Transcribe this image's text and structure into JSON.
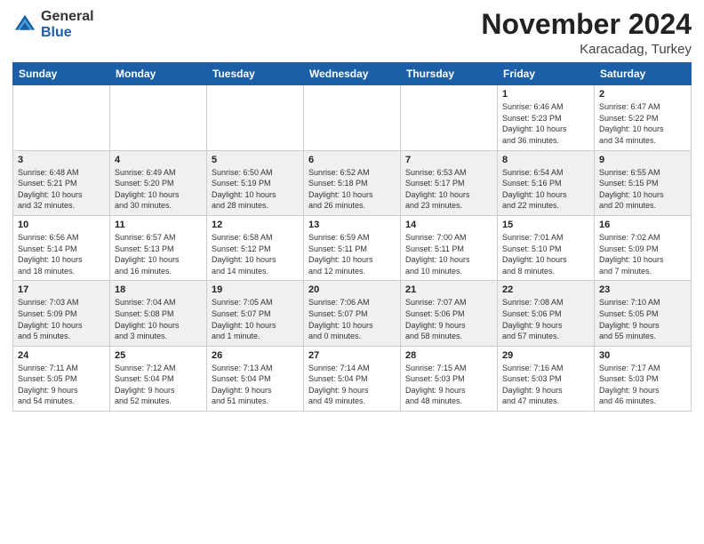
{
  "header": {
    "logo_line1": "General",
    "logo_line2": "Blue",
    "month": "November 2024",
    "location": "Karacadag, Turkey"
  },
  "columns": [
    "Sunday",
    "Monday",
    "Tuesday",
    "Wednesday",
    "Thursday",
    "Friday",
    "Saturday"
  ],
  "weeks": [
    [
      {
        "day": "",
        "info": ""
      },
      {
        "day": "",
        "info": ""
      },
      {
        "day": "",
        "info": ""
      },
      {
        "day": "",
        "info": ""
      },
      {
        "day": "",
        "info": ""
      },
      {
        "day": "1",
        "info": "Sunrise: 6:46 AM\nSunset: 5:23 PM\nDaylight: 10 hours\nand 36 minutes."
      },
      {
        "day": "2",
        "info": "Sunrise: 6:47 AM\nSunset: 5:22 PM\nDaylight: 10 hours\nand 34 minutes."
      }
    ],
    [
      {
        "day": "3",
        "info": "Sunrise: 6:48 AM\nSunset: 5:21 PM\nDaylight: 10 hours\nand 32 minutes."
      },
      {
        "day": "4",
        "info": "Sunrise: 6:49 AM\nSunset: 5:20 PM\nDaylight: 10 hours\nand 30 minutes."
      },
      {
        "day": "5",
        "info": "Sunrise: 6:50 AM\nSunset: 5:19 PM\nDaylight: 10 hours\nand 28 minutes."
      },
      {
        "day": "6",
        "info": "Sunrise: 6:52 AM\nSunset: 5:18 PM\nDaylight: 10 hours\nand 26 minutes."
      },
      {
        "day": "7",
        "info": "Sunrise: 6:53 AM\nSunset: 5:17 PM\nDaylight: 10 hours\nand 23 minutes."
      },
      {
        "day": "8",
        "info": "Sunrise: 6:54 AM\nSunset: 5:16 PM\nDaylight: 10 hours\nand 22 minutes."
      },
      {
        "day": "9",
        "info": "Sunrise: 6:55 AM\nSunset: 5:15 PM\nDaylight: 10 hours\nand 20 minutes."
      }
    ],
    [
      {
        "day": "10",
        "info": "Sunrise: 6:56 AM\nSunset: 5:14 PM\nDaylight: 10 hours\nand 18 minutes."
      },
      {
        "day": "11",
        "info": "Sunrise: 6:57 AM\nSunset: 5:13 PM\nDaylight: 10 hours\nand 16 minutes."
      },
      {
        "day": "12",
        "info": "Sunrise: 6:58 AM\nSunset: 5:12 PM\nDaylight: 10 hours\nand 14 minutes."
      },
      {
        "day": "13",
        "info": "Sunrise: 6:59 AM\nSunset: 5:11 PM\nDaylight: 10 hours\nand 12 minutes."
      },
      {
        "day": "14",
        "info": "Sunrise: 7:00 AM\nSunset: 5:11 PM\nDaylight: 10 hours\nand 10 minutes."
      },
      {
        "day": "15",
        "info": "Sunrise: 7:01 AM\nSunset: 5:10 PM\nDaylight: 10 hours\nand 8 minutes."
      },
      {
        "day": "16",
        "info": "Sunrise: 7:02 AM\nSunset: 5:09 PM\nDaylight: 10 hours\nand 7 minutes."
      }
    ],
    [
      {
        "day": "17",
        "info": "Sunrise: 7:03 AM\nSunset: 5:09 PM\nDaylight: 10 hours\nand 5 minutes."
      },
      {
        "day": "18",
        "info": "Sunrise: 7:04 AM\nSunset: 5:08 PM\nDaylight: 10 hours\nand 3 minutes."
      },
      {
        "day": "19",
        "info": "Sunrise: 7:05 AM\nSunset: 5:07 PM\nDaylight: 10 hours\nand 1 minute."
      },
      {
        "day": "20",
        "info": "Sunrise: 7:06 AM\nSunset: 5:07 PM\nDaylight: 10 hours\nand 0 minutes."
      },
      {
        "day": "21",
        "info": "Sunrise: 7:07 AM\nSunset: 5:06 PM\nDaylight: 9 hours\nand 58 minutes."
      },
      {
        "day": "22",
        "info": "Sunrise: 7:08 AM\nSunset: 5:06 PM\nDaylight: 9 hours\nand 57 minutes."
      },
      {
        "day": "23",
        "info": "Sunrise: 7:10 AM\nSunset: 5:05 PM\nDaylight: 9 hours\nand 55 minutes."
      }
    ],
    [
      {
        "day": "24",
        "info": "Sunrise: 7:11 AM\nSunset: 5:05 PM\nDaylight: 9 hours\nand 54 minutes."
      },
      {
        "day": "25",
        "info": "Sunrise: 7:12 AM\nSunset: 5:04 PM\nDaylight: 9 hours\nand 52 minutes."
      },
      {
        "day": "26",
        "info": "Sunrise: 7:13 AM\nSunset: 5:04 PM\nDaylight: 9 hours\nand 51 minutes."
      },
      {
        "day": "27",
        "info": "Sunrise: 7:14 AM\nSunset: 5:04 PM\nDaylight: 9 hours\nand 49 minutes."
      },
      {
        "day": "28",
        "info": "Sunrise: 7:15 AM\nSunset: 5:03 PM\nDaylight: 9 hours\nand 48 minutes."
      },
      {
        "day": "29",
        "info": "Sunrise: 7:16 AM\nSunset: 5:03 PM\nDaylight: 9 hours\nand 47 minutes."
      },
      {
        "day": "30",
        "info": "Sunrise: 7:17 AM\nSunset: 5:03 PM\nDaylight: 9 hours\nand 46 minutes."
      }
    ]
  ]
}
